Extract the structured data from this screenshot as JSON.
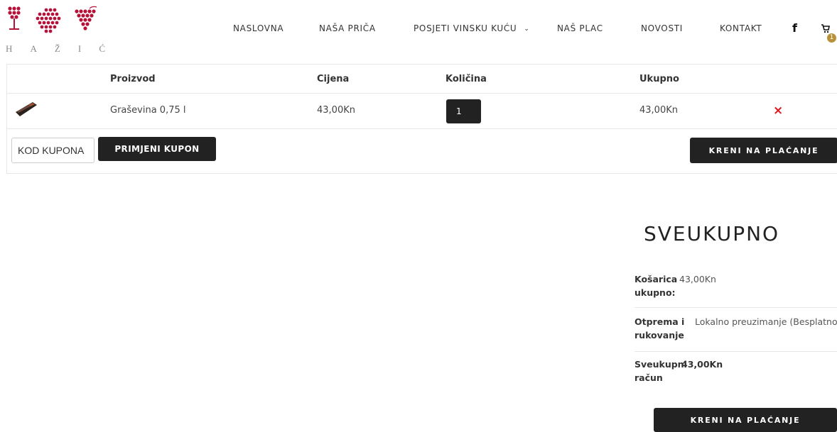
{
  "logo": {
    "letters": [
      "H",
      "A",
      "Ž",
      "I",
      "Ć"
    ],
    "brand_color": "#b5123a"
  },
  "nav": {
    "items": [
      {
        "label": "NASLOVNA"
      },
      {
        "label": "NAŠA PRIČA"
      },
      {
        "label": "POSJETI VINSKU KUĆU"
      },
      {
        "label": "NAŠ PLAC"
      },
      {
        "label": "NOVOSTI"
      },
      {
        "label": "KONTAKT"
      }
    ],
    "facebook_icon": "f",
    "cart_count": "1"
  },
  "cart": {
    "headers": {
      "product": "Proizvod",
      "price": "Cijena",
      "quantity": "Količina",
      "total": "Ukupno"
    },
    "items": [
      {
        "name": "Graševina 0,75 l",
        "price": "43,00Kn",
        "quantity": "1",
        "total": "43,00Kn",
        "remove": "×"
      }
    ],
    "coupon_placeholder": "KOD KUPONA",
    "apply_coupon_label": "PRIMJENI KUPON",
    "checkout_label": "KRENI NA PLAĆANJE"
  },
  "totals": {
    "title": "SVEUKUPNO",
    "subtotal_label_1": "Košarica",
    "subtotal_label_2": "ukupno:",
    "subtotal_value": "43,00Kn",
    "shipping_label_1": "Otprema i",
    "shipping_label_2": "rukovanje",
    "shipping_value": "Lokalno preuzimanje (Besplatno)",
    "grand_label_1": "Sveukupni",
    "grand_label_2": "račun",
    "grand_value": "43,00Kn",
    "checkout_label": "KRENI NA PLAĆANJE"
  },
  "colors": {
    "dark_button": "#222222",
    "remove_red": "#e0141e",
    "badge_gold": "#b8913a"
  }
}
